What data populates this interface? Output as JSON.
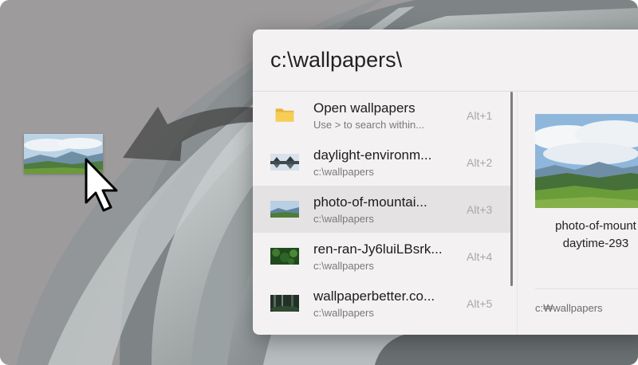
{
  "search": {
    "value": "c:\\wallpapers\\"
  },
  "results": [
    {
      "title": "Open wallpapers",
      "subtitle": "Use > to search within...",
      "hotkey": "Alt+1",
      "icon": "folder-icon"
    },
    {
      "title": "daylight-environm...",
      "subtitle": "c:\\wallpapers",
      "hotkey": "Alt+2",
      "icon": "image-thumbnail-lake-icon"
    },
    {
      "title": "photo-of-mountai...",
      "subtitle": "c:\\wallpapers",
      "hotkey": "Alt+3",
      "icon": "image-thumbnail-mountain-icon"
    },
    {
      "title": "ren-ran-Jy6luiLBsrk...",
      "subtitle": "c:\\wallpapers",
      "hotkey": "Alt+4",
      "icon": "image-thumbnail-leaves-icon"
    },
    {
      "title": "wallpaperbetter.co...",
      "subtitle": "c:\\wallpapers",
      "hotkey": "Alt+5",
      "icon": "image-thumbnail-forest-icon"
    }
  ],
  "selected_index": 2,
  "preview": {
    "title_line1": "photo-of-mount",
    "title_line2": "daytime-293",
    "path": "c:₩wallpapers"
  },
  "colors": {
    "selection": "#e4e2e3",
    "panel": "#f3f1f2"
  }
}
